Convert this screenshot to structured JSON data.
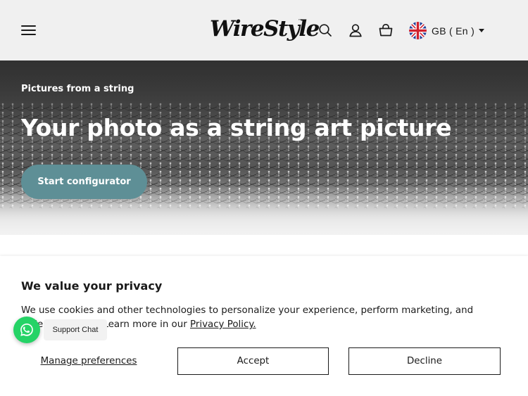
{
  "header": {
    "logo_text": "WireStyle",
    "logo_tm": "™",
    "menu_icon": "hamburger-menu-icon",
    "search_icon": "search-icon",
    "account_icon": "user-account-icon",
    "cart_icon": "shopping-basket-icon",
    "language": {
      "flag_icon": "uk-flag-icon",
      "label": "GB ( En )",
      "caret_icon": "caret-down-icon"
    }
  },
  "hero": {
    "eyebrow": "Pictures from a string",
    "title": "Your photo as a string art picture",
    "cta_label": "Start configurator",
    "cta_color": "#5e8f96"
  },
  "cookie_banner": {
    "title": "We value your privacy",
    "text_before": "We use cookies and other technologies to personalize your experience, perform marketing, and collect analytics. Learn more in our ",
    "link_text": "Privacy Policy.",
    "manage_label": "Manage preferences",
    "accept_label": "Accept",
    "decline_label": "Decline"
  },
  "support_chat": {
    "icon": "whatsapp-icon",
    "label": "Support Chat",
    "color": "#25d366"
  }
}
